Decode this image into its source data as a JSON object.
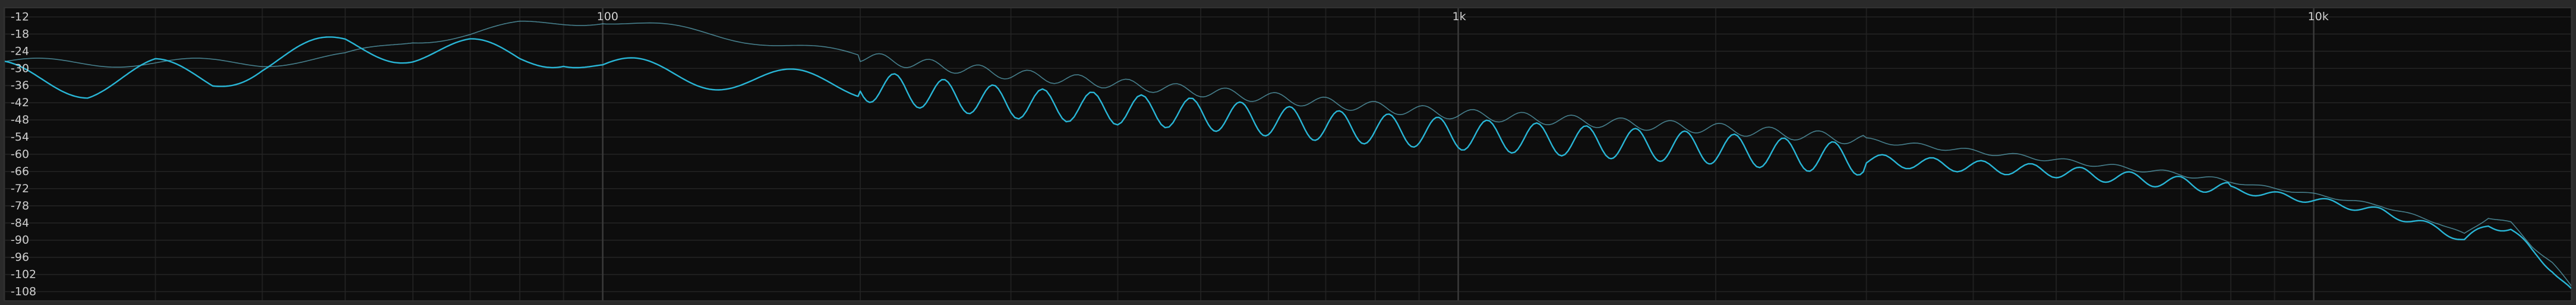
{
  "chart_data": {
    "type": "line",
    "title": "",
    "xlabel": "",
    "ylabel": "",
    "x_scale": "log",
    "xlim": [
      20,
      20000
    ],
    "ylim": [
      -111,
      -9
    ],
    "grid": true,
    "y_tick_values": [
      -12,
      -18,
      -24,
      -30,
      -36,
      -42,
      -48,
      -54,
      -60,
      -66,
      -72,
      -78,
      -84,
      -90,
      -96,
      -102,
      -108
    ],
    "y_tick_labels": [
      "-12",
      "-18",
      "-24",
      "-30",
      "-36",
      "-42",
      "-48",
      "-54",
      "-60",
      "-66",
      "-72",
      "-78",
      "-84",
      "-90",
      "-96",
      "-102",
      "-108"
    ],
    "x_tick_values": [
      100,
      1000,
      10000
    ],
    "x_tick_labels": [
      "100",
      "1k",
      "10k"
    ],
    "series": [
      {
        "role": "peak-hold",
        "color": "#5aa6b7",
        "x": [
          20,
          30,
          40,
          50,
          60,
          70,
          80,
          90,
          100,
          150,
          200,
          300,
          500,
          700,
          1000,
          1500,
          2000,
          3000,
          5000,
          7000,
          10000,
          12000,
          14000,
          15000,
          16000,
          17000,
          18000,
          19000,
          20000
        ],
        "y": [
          -28,
          -28,
          -28,
          -26,
          -20,
          -18,
          -15,
          -14,
          -13,
          -20,
          -26,
          -32,
          -38,
          -42,
          -46,
          -49,
          -51,
          -55,
          -62,
          -67,
          -74,
          -78,
          -84,
          -88,
          -82,
          -84,
          -92,
          -98,
          -106
        ]
      },
      {
        "role": "live",
        "color": "#29b6d6",
        "x": [
          20,
          25,
          30,
          35,
          40,
          50,
          60,
          70,
          80,
          90,
          100,
          150,
          200,
          300,
          500,
          700,
          1000,
          1500,
          2000,
          3000,
          5000,
          7000,
          10000,
          12000,
          14000,
          15000,
          16000,
          17000,
          18000,
          19000,
          20000
        ],
        "y": [
          -32,
          -36,
          -31,
          -34,
          -28,
          -22,
          -24,
          -24,
          -26,
          -25,
          -30,
          -34,
          -36,
          -42,
          -46,
          -50,
          -53,
          -56,
          -58,
          -62,
          -66,
          -70,
          -76,
          -80,
          -86,
          -90,
          -85,
          -86,
          -94,
          -100,
          -108
        ]
      }
    ]
  }
}
